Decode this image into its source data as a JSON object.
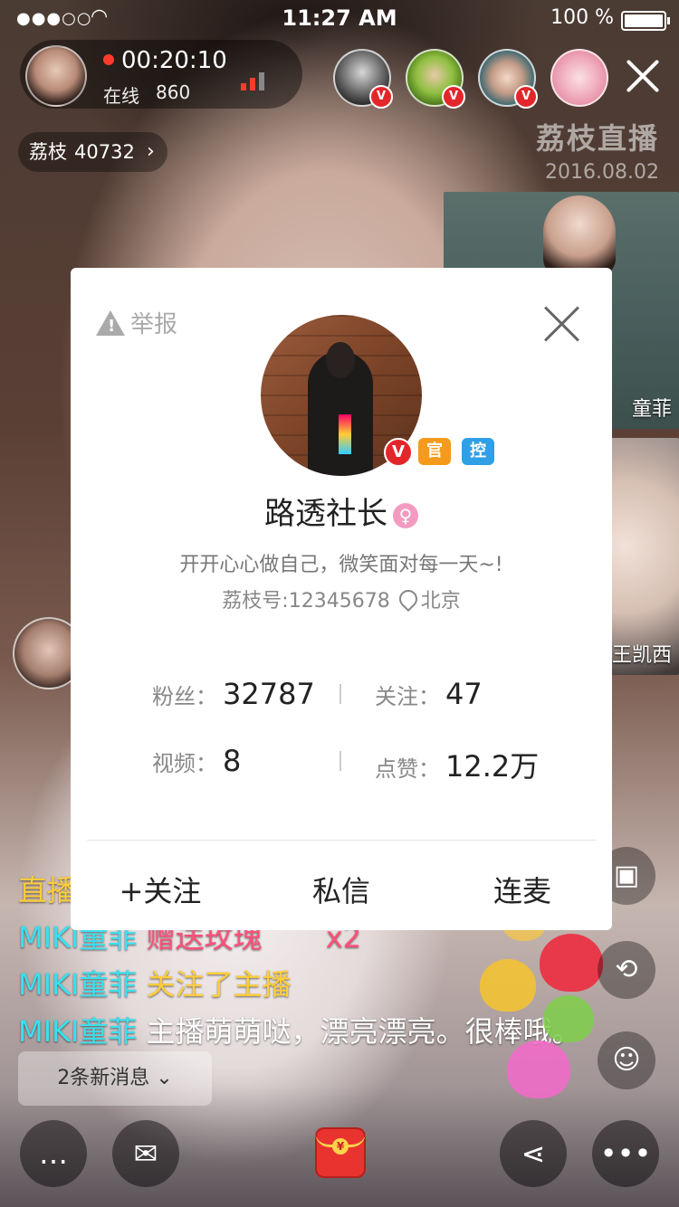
{
  "status_bar": {
    "signal": "●●●○○",
    "time": "11:27 AM",
    "battery": "100 %"
  },
  "host": {
    "duration": "00:20:10",
    "online_label": "在线",
    "online_count": "860"
  },
  "coins": {
    "label": "荔枝",
    "value": "40732"
  },
  "watermark": {
    "brand": "荔枝直播",
    "date": "2016.08.02"
  },
  "cohosts": [
    {
      "name": "童菲"
    },
    {
      "name": "王凯西"
    }
  ],
  "chat": {
    "partial_prefix": "直播",
    "messages": [
      {
        "user": "MIKI童菲",
        "text": "赠送玫瑰",
        "suffix": "x2",
        "style": "pink"
      },
      {
        "user": "MIKI童菲",
        "text": "关注了主播",
        "style": "yellow"
      },
      {
        "user": "MIKI童菲",
        "text": "主播萌萌哒，漂亮漂亮。很棒哦。",
        "style": "white"
      }
    ],
    "new_messages": "2条新消息"
  },
  "profile": {
    "report": "举报",
    "nickname": "路透社长",
    "badges": {
      "verified": "V",
      "official": "官",
      "control": "控"
    },
    "bio": "开开心心做自己，微笑面对每一天~!",
    "id_label": "荔枝号:12345678",
    "location": "北京",
    "stats": {
      "fans_label": "粉丝：",
      "fans": "32787",
      "following_label": "关注：",
      "following": "47",
      "videos_label": "视频：",
      "videos": "8",
      "likes_label": "点赞：",
      "likes": "12.2万"
    },
    "actions": {
      "follow": "+关注",
      "message": "私信",
      "link_mic": "连麦"
    }
  },
  "colors": {
    "accent_red": "#e3262a",
    "chat_user": "#39e0f0",
    "chat_yellow": "#ffce3a",
    "chat_pink": "#ff4f7a",
    "official_badge": "#f59a1b",
    "control_badge": "#2f9fe6"
  },
  "icons": [
    "wifi-icon",
    "battery-icon",
    "close-icon",
    "chevron-right-icon",
    "chat-icon",
    "mail-icon",
    "gift-icon",
    "share-icon",
    "more-icon",
    "photo-icon",
    "camera-switch-icon",
    "live-user-icon",
    "warning-icon",
    "location-pin-icon",
    "female-icon"
  ]
}
